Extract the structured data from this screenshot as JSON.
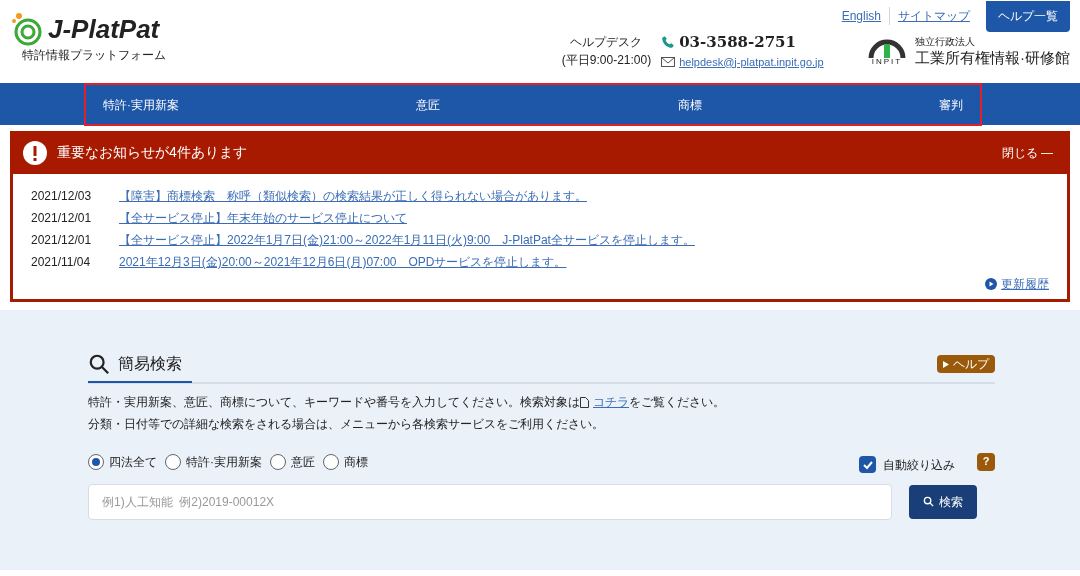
{
  "header": {
    "logo_text": "J-PlatPat",
    "logo_subtitle": "特許情報プラットフォーム",
    "helpdesk_label": "ヘルプデスク",
    "helpdesk_hours": "(平日9:00-21:00)",
    "phone": "03-3588-2751",
    "email": "helpdesk@j-platpat.inpit.go.jp",
    "org_small": "独立行政法人",
    "org_name": "工業所有権情報·研修館",
    "org_logo_text": "INPIT",
    "links": [
      "English",
      "サイトマップ"
    ],
    "help_button": "ヘルプ一覧"
  },
  "nav": [
    {
      "label": "特許·実用新案"
    },
    {
      "label": "意匠"
    },
    {
      "label": "商標"
    },
    {
      "label": "審判"
    }
  ],
  "notice": {
    "title": "重要なお知らせが4件あります",
    "close": "閉じる —",
    "items": [
      {
        "date": "2021/12/03",
        "text": "【障害】商標検索　称呼（類似検索）の検索結果が正しく得られない場合があります。"
      },
      {
        "date": "2021/12/01",
        "text": "【全サービス停止】年末年始のサービス停止について"
      },
      {
        "date": "2021/12/01",
        "text": "【全サービス停止】2022年1月7日(金)21:00～2022年1月11日(火)9:00　J-PlatPat全サービスを停止します。"
      },
      {
        "date": "2021/11/04",
        "text": "2021年12月3日(金)20:00～2021年12月6日(月)07:00　OPDサービスを停止します。"
      }
    ],
    "history_link": "更新履歴"
  },
  "search": {
    "title": "簡易検索",
    "help": "ヘルプ",
    "desc_before": "特許・実用新案、意匠、商標について、キーワードや番号を入力してください。検索対象は",
    "desc_link": "コチラ",
    "desc_after": "をご覧ください。",
    "desc2": "分類・日付等での詳細な検索をされる場合は、メニューから各検索サービスをご利用ください。",
    "options": [
      {
        "label": "四法全て",
        "selected": true
      },
      {
        "label": "特許·実用新案",
        "selected": false
      },
      {
        "label": "意匠",
        "selected": false
      },
      {
        "label": "商標",
        "selected": false
      }
    ],
    "auto_filter": {
      "label": "自動絞り込み",
      "checked": true
    },
    "hint": "?",
    "placeholder": "例1)人工知能  例2)2019-00012X",
    "button": "検索"
  }
}
